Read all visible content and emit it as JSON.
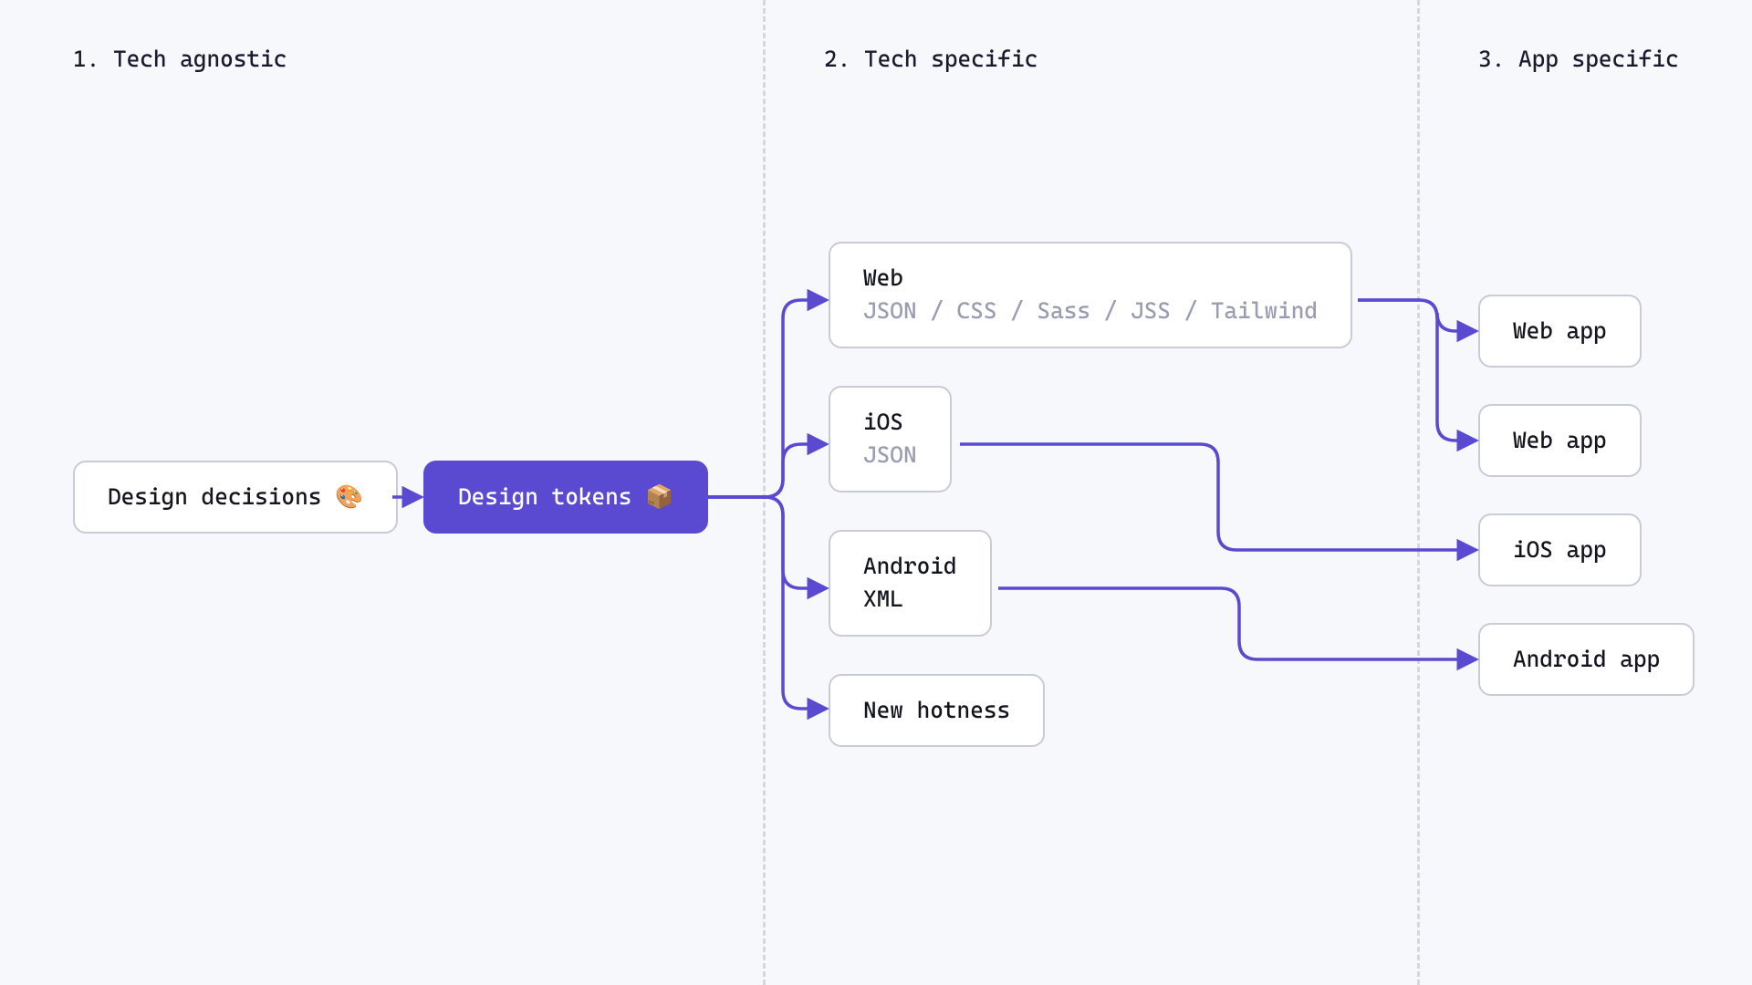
{
  "sections": {
    "s1": "1. Tech agnostic",
    "s2": "2. Tech specific",
    "s3": "3. App specific"
  },
  "nodes": {
    "decisions": "Design decisions 🎨",
    "tokens": "Design tokens 📦",
    "web": {
      "title": "Web",
      "sub": "JSON / CSS / Sass / JSS / Tailwind"
    },
    "ios": {
      "title": "iOS",
      "sub": "JSON"
    },
    "android": {
      "title": "Android",
      "sub": "XML"
    },
    "new": "New hotness",
    "app_web1": "Web app",
    "app_web2": "Web app",
    "app_ios": "iOS app",
    "app_android": "Android app"
  },
  "colors": {
    "accent": "#5a4ad1"
  }
}
